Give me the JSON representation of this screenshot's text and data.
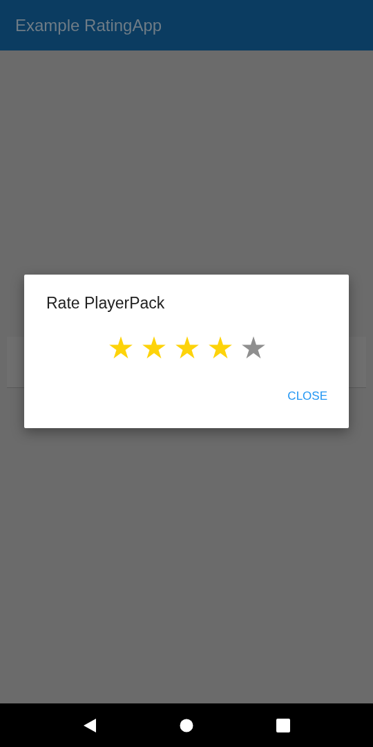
{
  "app_bar": {
    "title": "Example RatingApp"
  },
  "dialog": {
    "title": "Rate PlayerPack",
    "stars": 4,
    "buttons": [
      "CLOSE"
    ]
  }
}
